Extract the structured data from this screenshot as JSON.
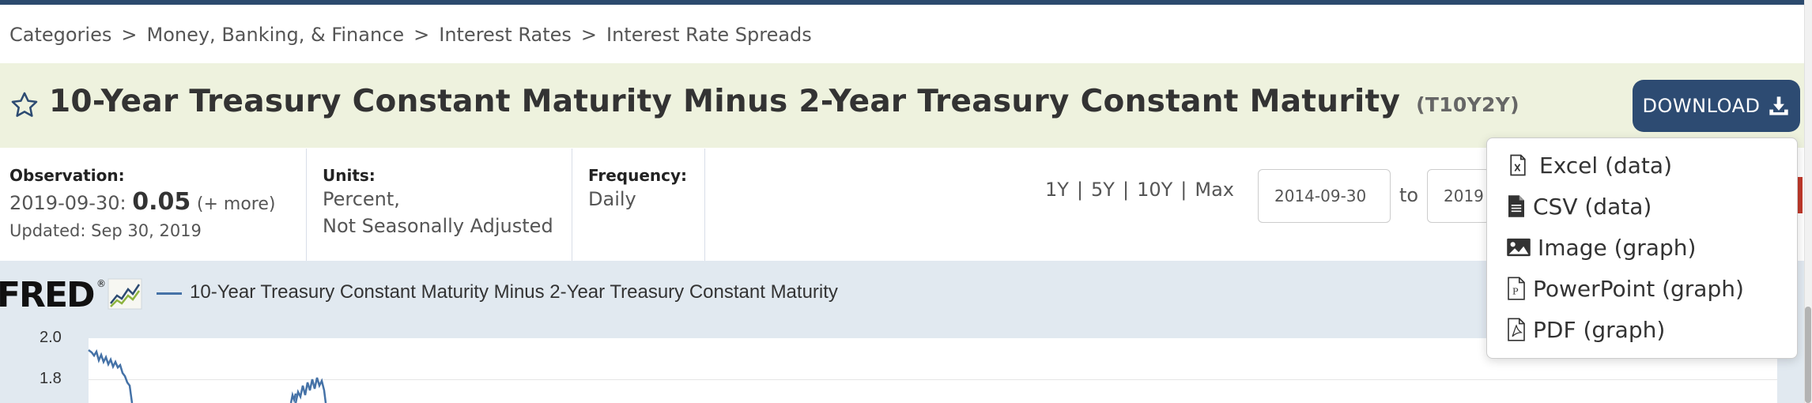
{
  "breadcrumb": {
    "items": [
      "Categories",
      "Money, Banking, & Finance",
      "Interest Rates",
      "Interest Rate Spreads"
    ],
    "separator": ">"
  },
  "header": {
    "title": "10-Year Treasury Constant Maturity Minus 2-Year Treasury Constant Maturity",
    "series_id": "(T10Y2Y)",
    "download_label": "DOWNLOAD"
  },
  "observation": {
    "label": "Observation:",
    "date": "2019-09-30:",
    "value": "0.05",
    "more": "(+ more)",
    "updated": "Updated: Sep 30, 2019"
  },
  "units": {
    "label": "Units:",
    "line1": "Percent,",
    "line2": "Not Seasonally Adjusted"
  },
  "frequency": {
    "label": "Frequency:",
    "value": "Daily"
  },
  "range_buttons": [
    "1Y",
    "5Y",
    "10Y",
    "Max"
  ],
  "range_separator": "|",
  "date_range": {
    "start": "2014-09-30",
    "to_label": "to",
    "end": "2019"
  },
  "download_menu": {
    "items": [
      "Excel (data)",
      "CSV (data)",
      "Image (graph)",
      "PowerPoint (graph)",
      "PDF (graph)"
    ]
  },
  "graph": {
    "logo": "FRED",
    "legend": "10-Year Treasury Constant Maturity Minus 2-Year Treasury Constant Maturity",
    "y_ticks": [
      "2.0",
      "1.8"
    ],
    "series_color": "#4572a7"
  },
  "colors": {
    "brand_navy": "#2d4b72",
    "title_band": "#eef2de",
    "graph_band": "#e1e9f0"
  }
}
